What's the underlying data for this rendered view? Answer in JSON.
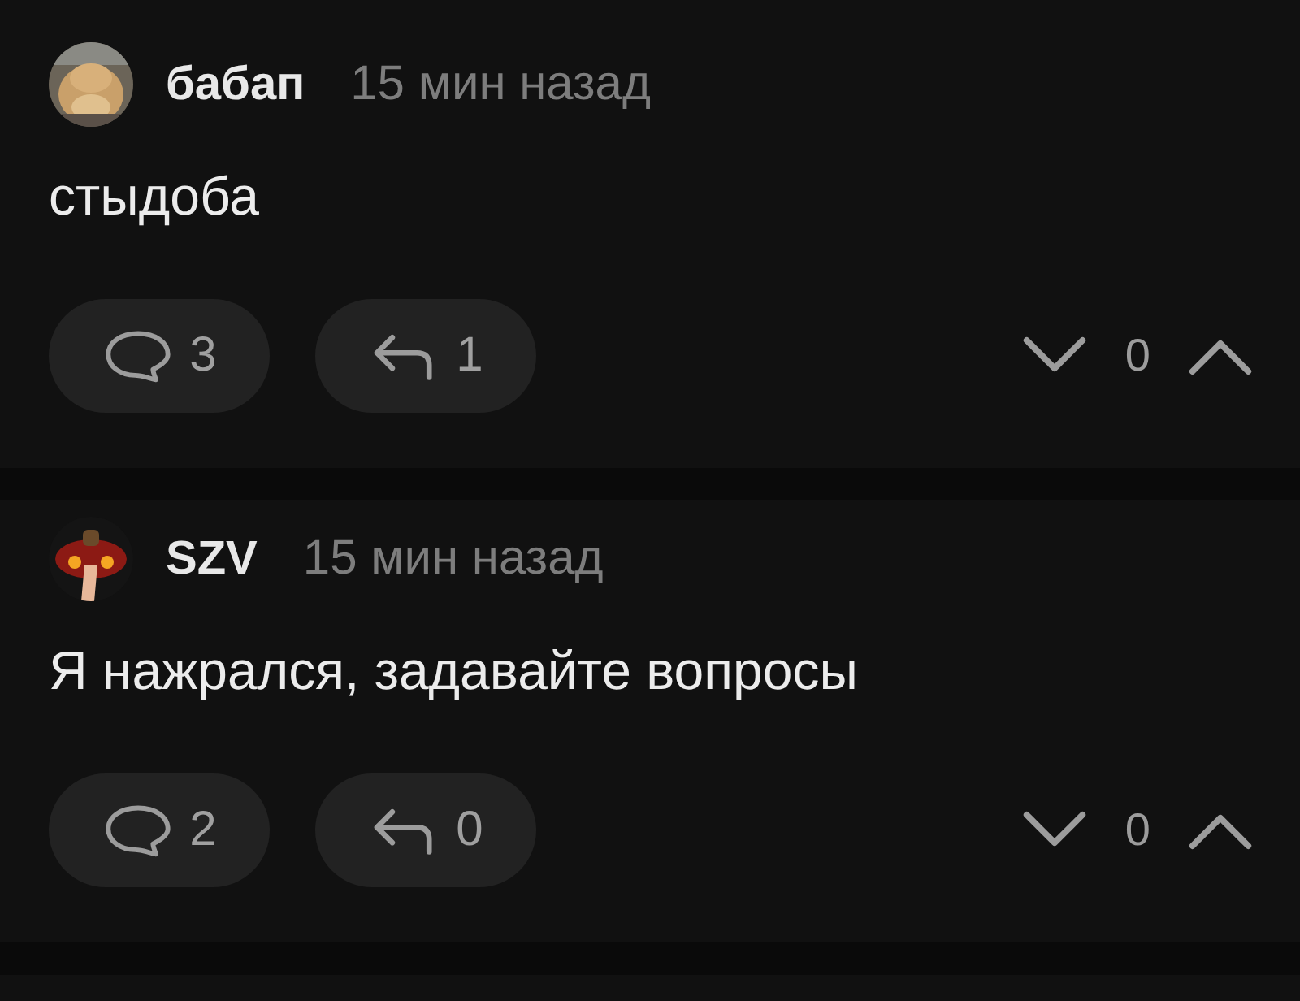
{
  "comments": [
    {
      "author": "бабап",
      "time": "15 мин назад",
      "text": "стыдоба",
      "replies": "3",
      "reply_count": "1",
      "score": "0"
    },
    {
      "author": "SZV",
      "time": "15 мин назад",
      "text": "Я нажрался, задавайте вопросы",
      "replies": "2",
      "reply_count": "0",
      "score": "0"
    }
  ]
}
